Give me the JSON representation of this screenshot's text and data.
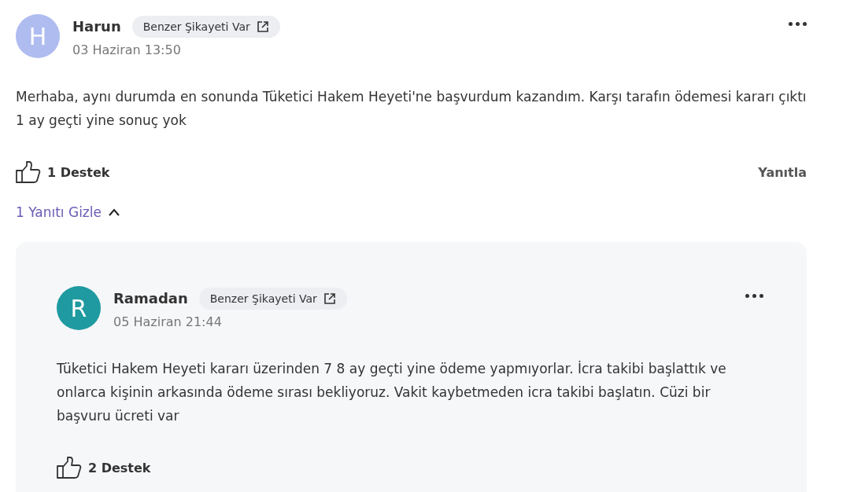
{
  "comment": {
    "author": "Harun",
    "initial": "H",
    "color": "#aebcf0",
    "badge": "Benzer Şikayeti Var",
    "date": "03 Haziran 13:50",
    "text": "Merhaba, aynı durumda en sonunda Tüketici Hakem Heyeti'ne başvurdum kazandım. Karşı tarafın ödemesi kararı çıktı 1 ay geçti yine sonuç yok",
    "support": "1 Destek",
    "reply_label": "Yanıtla",
    "replies_toggle": "1 Yanıtı Gizle",
    "replies_expanded": true
  },
  "replies": [
    {
      "author": "Ramadan",
      "initial": "R",
      "color": "#1e9aa0",
      "badge": "Benzer Şikayeti Var",
      "date": "05 Haziran 21:44",
      "text": "Tüketici Hakem Heyeti kararı üzerinden 7 8 ay geçti yine ödeme yapmıyorlar. İcra takibi başlattık ve onlarca kişinin arkasında ödeme sırası bekliyoruz. Vakit kaybetmeden icra takibi başlatın. Cüzi bir başvuru ücreti var",
      "support": "2 Destek"
    }
  ]
}
